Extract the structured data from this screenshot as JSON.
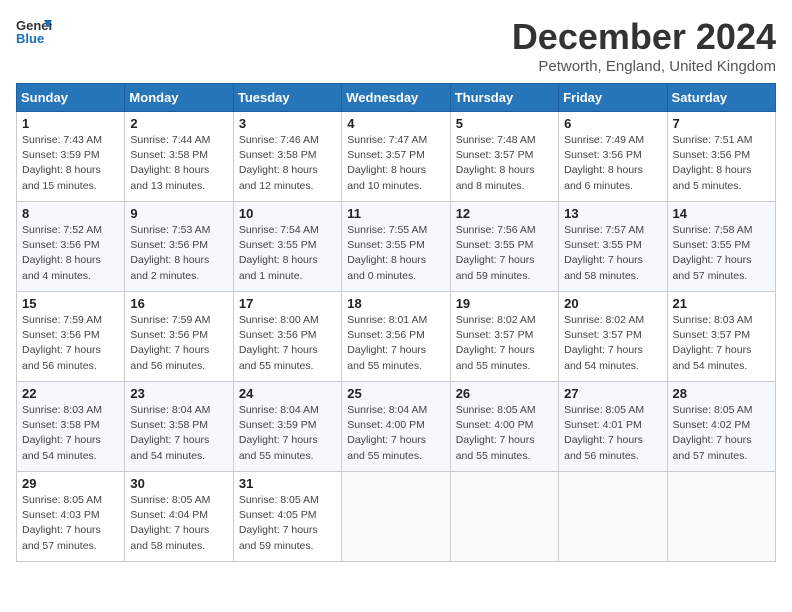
{
  "logo": {
    "line1": "General",
    "line2": "Blue"
  },
  "title": "December 2024",
  "location": "Petworth, England, United Kingdom",
  "weekdays": [
    "Sunday",
    "Monday",
    "Tuesday",
    "Wednesday",
    "Thursday",
    "Friday",
    "Saturday"
  ],
  "weeks": [
    [
      {
        "day": "1",
        "info": "Sunrise: 7:43 AM\nSunset: 3:59 PM\nDaylight: 8 hours\nand 15 minutes."
      },
      {
        "day": "2",
        "info": "Sunrise: 7:44 AM\nSunset: 3:58 PM\nDaylight: 8 hours\nand 13 minutes."
      },
      {
        "day": "3",
        "info": "Sunrise: 7:46 AM\nSunset: 3:58 PM\nDaylight: 8 hours\nand 12 minutes."
      },
      {
        "day": "4",
        "info": "Sunrise: 7:47 AM\nSunset: 3:57 PM\nDaylight: 8 hours\nand 10 minutes."
      },
      {
        "day": "5",
        "info": "Sunrise: 7:48 AM\nSunset: 3:57 PM\nDaylight: 8 hours\nand 8 minutes."
      },
      {
        "day": "6",
        "info": "Sunrise: 7:49 AM\nSunset: 3:56 PM\nDaylight: 8 hours\nand 6 minutes."
      },
      {
        "day": "7",
        "info": "Sunrise: 7:51 AM\nSunset: 3:56 PM\nDaylight: 8 hours\nand 5 minutes."
      }
    ],
    [
      {
        "day": "8",
        "info": "Sunrise: 7:52 AM\nSunset: 3:56 PM\nDaylight: 8 hours\nand 4 minutes."
      },
      {
        "day": "9",
        "info": "Sunrise: 7:53 AM\nSunset: 3:56 PM\nDaylight: 8 hours\nand 2 minutes."
      },
      {
        "day": "10",
        "info": "Sunrise: 7:54 AM\nSunset: 3:55 PM\nDaylight: 8 hours\nand 1 minute."
      },
      {
        "day": "11",
        "info": "Sunrise: 7:55 AM\nSunset: 3:55 PM\nDaylight: 8 hours\nand 0 minutes."
      },
      {
        "day": "12",
        "info": "Sunrise: 7:56 AM\nSunset: 3:55 PM\nDaylight: 7 hours\nand 59 minutes."
      },
      {
        "day": "13",
        "info": "Sunrise: 7:57 AM\nSunset: 3:55 PM\nDaylight: 7 hours\nand 58 minutes."
      },
      {
        "day": "14",
        "info": "Sunrise: 7:58 AM\nSunset: 3:55 PM\nDaylight: 7 hours\nand 57 minutes."
      }
    ],
    [
      {
        "day": "15",
        "info": "Sunrise: 7:59 AM\nSunset: 3:56 PM\nDaylight: 7 hours\nand 56 minutes."
      },
      {
        "day": "16",
        "info": "Sunrise: 7:59 AM\nSunset: 3:56 PM\nDaylight: 7 hours\nand 56 minutes."
      },
      {
        "day": "17",
        "info": "Sunrise: 8:00 AM\nSunset: 3:56 PM\nDaylight: 7 hours\nand 55 minutes."
      },
      {
        "day": "18",
        "info": "Sunrise: 8:01 AM\nSunset: 3:56 PM\nDaylight: 7 hours\nand 55 minutes."
      },
      {
        "day": "19",
        "info": "Sunrise: 8:02 AM\nSunset: 3:57 PM\nDaylight: 7 hours\nand 55 minutes."
      },
      {
        "day": "20",
        "info": "Sunrise: 8:02 AM\nSunset: 3:57 PM\nDaylight: 7 hours\nand 54 minutes."
      },
      {
        "day": "21",
        "info": "Sunrise: 8:03 AM\nSunset: 3:57 PM\nDaylight: 7 hours\nand 54 minutes."
      }
    ],
    [
      {
        "day": "22",
        "info": "Sunrise: 8:03 AM\nSunset: 3:58 PM\nDaylight: 7 hours\nand 54 minutes."
      },
      {
        "day": "23",
        "info": "Sunrise: 8:04 AM\nSunset: 3:58 PM\nDaylight: 7 hours\nand 54 minutes."
      },
      {
        "day": "24",
        "info": "Sunrise: 8:04 AM\nSunset: 3:59 PM\nDaylight: 7 hours\nand 55 minutes."
      },
      {
        "day": "25",
        "info": "Sunrise: 8:04 AM\nSunset: 4:00 PM\nDaylight: 7 hours\nand 55 minutes."
      },
      {
        "day": "26",
        "info": "Sunrise: 8:05 AM\nSunset: 4:00 PM\nDaylight: 7 hours\nand 55 minutes."
      },
      {
        "day": "27",
        "info": "Sunrise: 8:05 AM\nSunset: 4:01 PM\nDaylight: 7 hours\nand 56 minutes."
      },
      {
        "day": "28",
        "info": "Sunrise: 8:05 AM\nSunset: 4:02 PM\nDaylight: 7 hours\nand 57 minutes."
      }
    ],
    [
      {
        "day": "29",
        "info": "Sunrise: 8:05 AM\nSunset: 4:03 PM\nDaylight: 7 hours\nand 57 minutes."
      },
      {
        "day": "30",
        "info": "Sunrise: 8:05 AM\nSunset: 4:04 PM\nDaylight: 7 hours\nand 58 minutes."
      },
      {
        "day": "31",
        "info": "Sunrise: 8:05 AM\nSunset: 4:05 PM\nDaylight: 7 hours\nand 59 minutes."
      },
      {
        "day": "",
        "info": ""
      },
      {
        "day": "",
        "info": ""
      },
      {
        "day": "",
        "info": ""
      },
      {
        "day": "",
        "info": ""
      }
    ]
  ]
}
